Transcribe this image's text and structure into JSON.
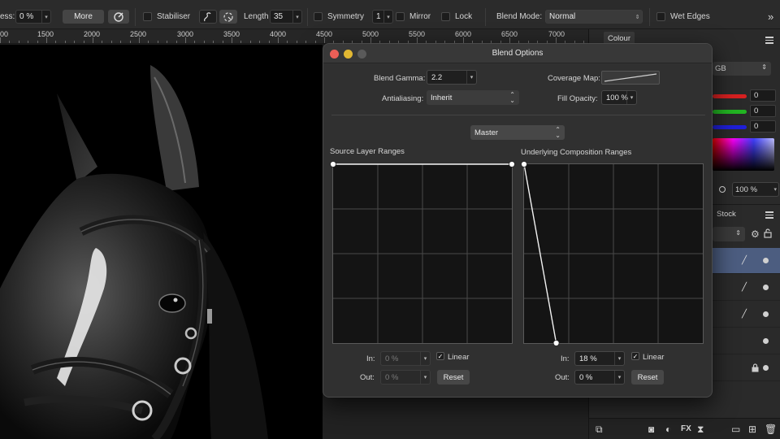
{
  "toolbar": {
    "opacity_label": "ess:",
    "opacity_value": "0 %",
    "more_label": "More",
    "stabiliser_label": "Stabiliser",
    "length_label": "Length",
    "length_value": "35",
    "symmetry_label": "Symmetry",
    "symmetry_value": "1",
    "mirror_label": "Mirror",
    "lock_label": "Lock",
    "blend_mode_label": "Blend Mode:",
    "blend_mode_value": "Normal",
    "wet_edges_label": "Wet Edges",
    "overflow_icon": "»"
  },
  "ruler": {
    "labels": [
      "00",
      "1500",
      "2000",
      "2500",
      "3000",
      "3500",
      "4000",
      "4500",
      "5000",
      "5500",
      "6000",
      "6500",
      "7000"
    ]
  },
  "panel": {
    "colour_tab": "Colour",
    "color_model": "GB",
    "r_value": "0",
    "g_value": "0",
    "b_value": "0",
    "opacity_value": "100 %",
    "stock_tab": "Stock",
    "colors": {
      "red": "#d62020",
      "green": "#22b522",
      "blue": "#1f1fd8",
      "selected_row": "#4c5d80"
    }
  },
  "dialog": {
    "title": "Blend Options",
    "blend_gamma_label": "Blend Gamma:",
    "blend_gamma_value": "2.2",
    "coverage_map_label": "Coverage Map:",
    "antialiasing_label": "Antialiasing:",
    "antialiasing_value": "Inherit",
    "fill_opacity_label": "Fill Opacity:",
    "fill_opacity_value": "100 %",
    "channel_value": "Master",
    "source_title": "Source Layer Ranges",
    "underlying_title": "Underlying Composition Ranges",
    "source_in_label": "In:",
    "source_in_value": "0 %",
    "source_out_label": "Out:",
    "source_out_value": "0 %",
    "source_linear_label": "Linear",
    "source_reset_label": "Reset",
    "under_in_label": "In:",
    "under_in_value": "18 %",
    "under_out_label": "Out:",
    "under_out_value": "0 %",
    "under_linear_label": "Linear",
    "under_reset_label": "Reset",
    "source_curve": [
      [
        0,
        1
      ],
      [
        1,
        1
      ]
    ],
    "underlying_curve": [
      [
        0,
        1
      ],
      [
        0.18,
        0
      ]
    ]
  }
}
